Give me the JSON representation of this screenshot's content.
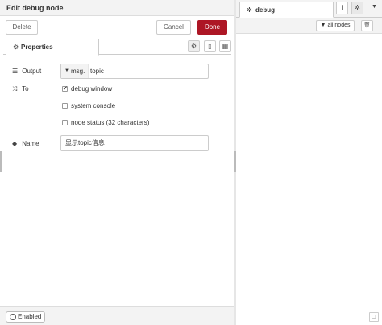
{
  "tray": {
    "title": "Edit debug node",
    "delete_label": "Delete",
    "cancel_label": "Cancel",
    "done_label": "Done",
    "tabs": [
      {
        "label": "Properties",
        "icon": "gear-icon"
      }
    ],
    "tools": [
      "gear-icon",
      "document-icon",
      "layout-icon"
    ]
  },
  "form": {
    "output": {
      "label": "Output",
      "type_prefix": "msg.",
      "value": "topic"
    },
    "to": {
      "label": "To",
      "options": [
        {
          "label": "debug window",
          "checked": true
        },
        {
          "label": "system console",
          "checked": false
        },
        {
          "label": "node status (32 characters)",
          "checked": false
        }
      ]
    },
    "name": {
      "label": "Name",
      "value": "显示topic信息"
    }
  },
  "footer": {
    "enabled_label": "Enabled"
  },
  "sidebar": {
    "tab_label": "debug",
    "filter_label": "all nodes",
    "info_icon": "i",
    "colors": {
      "done": "#ad1625",
      "panel": "#f3f3f3",
      "border": "#cccccc"
    }
  }
}
